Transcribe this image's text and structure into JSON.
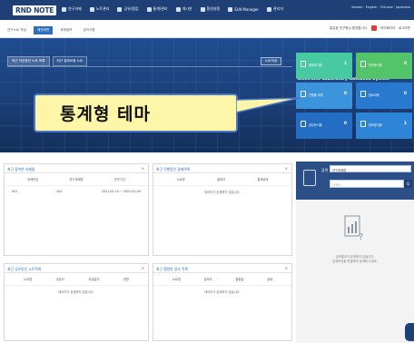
{
  "brand": {
    "logo": "RND NOTE"
  },
  "nav": {
    "items": [
      {
        "label": "연구과제"
      },
      {
        "label": "노트관리"
      },
      {
        "label": "공유/협업"
      },
      {
        "label": "통계/관리"
      },
      {
        "label": "게시판"
      },
      {
        "label": "환경설정"
      },
      {
        "label": "ELN Manager"
      },
      {
        "label": "관리자"
      }
    ],
    "right_text": "Korean · English · Chinese · Japanese"
  },
  "subbar": {
    "tabs": [
      {
        "label": "연구노트 작성"
      },
      {
        "label": "메인화면"
      },
      {
        "label": "과제정보"
      },
      {
        "label": "공지사항"
      }
    ],
    "user_text": "홍길동 연구원님 환영합니다.",
    "mypage": "마이페이지",
    "logout": "로그아웃"
  },
  "hero": {
    "tabs": [
      {
        "label": "최근 작성중인 노트 목록"
      },
      {
        "label": "최근 결재요청 노트"
      }
    ],
    "new_note_label": "노트작성",
    "system_title": "Electronic Laboratory Notebook System",
    "tiles": [
      {
        "label": "결재대기함",
        "count": "1"
      },
      {
        "label": "반려문서함",
        "count": "0"
      },
      {
        "label": "진행중 과제",
        "count": "0"
      },
      {
        "label": "완료과제",
        "count": "0"
      },
      {
        "label": "공유문서함",
        "count": "0"
      },
      {
        "label": "참조문서함",
        "count": "1"
      }
    ]
  },
  "callout": {
    "text": "통계형 테마"
  },
  "panels": {
    "recent_projects": {
      "title": "최근 참여한 과제들",
      "columns": [
        "과제번호",
        "연구과제명",
        "연구기간"
      ],
      "rows": [
        [
          "001",
          "001",
          "2021-02-10 ~ 2022-02-09"
        ]
      ]
    },
    "pending_approval": {
      "title": "최근 진행중인 결재목록",
      "columns": [
        "노트명",
        "결재자",
        "결재상태"
      ],
      "empty": "데이터가 존재하지 않습니다."
    },
    "shared_notes": {
      "title": "최근 공유받은 노트목록",
      "columns": [
        "노트명",
        "공유자",
        "공유일자",
        "권한"
      ],
      "empty": "데이터가 존재하지 않습니다."
    },
    "referenced_notes": {
      "title": "최근 열람한 참조 목록",
      "columns": [
        "노트명",
        "참조자",
        "열람일",
        "상태"
      ],
      "empty": "데이터가 존재하지 않습니다."
    }
  },
  "sidebar": {
    "search_label": "검색",
    "select_value": "연구과제명",
    "search_placeholder": "검색어...",
    "search_button": "Q",
    "empty_line1": "검색결과가 존재하지 않습니다.",
    "empty_line2": "검색조건을 변경하여 검색해 주세요."
  }
}
